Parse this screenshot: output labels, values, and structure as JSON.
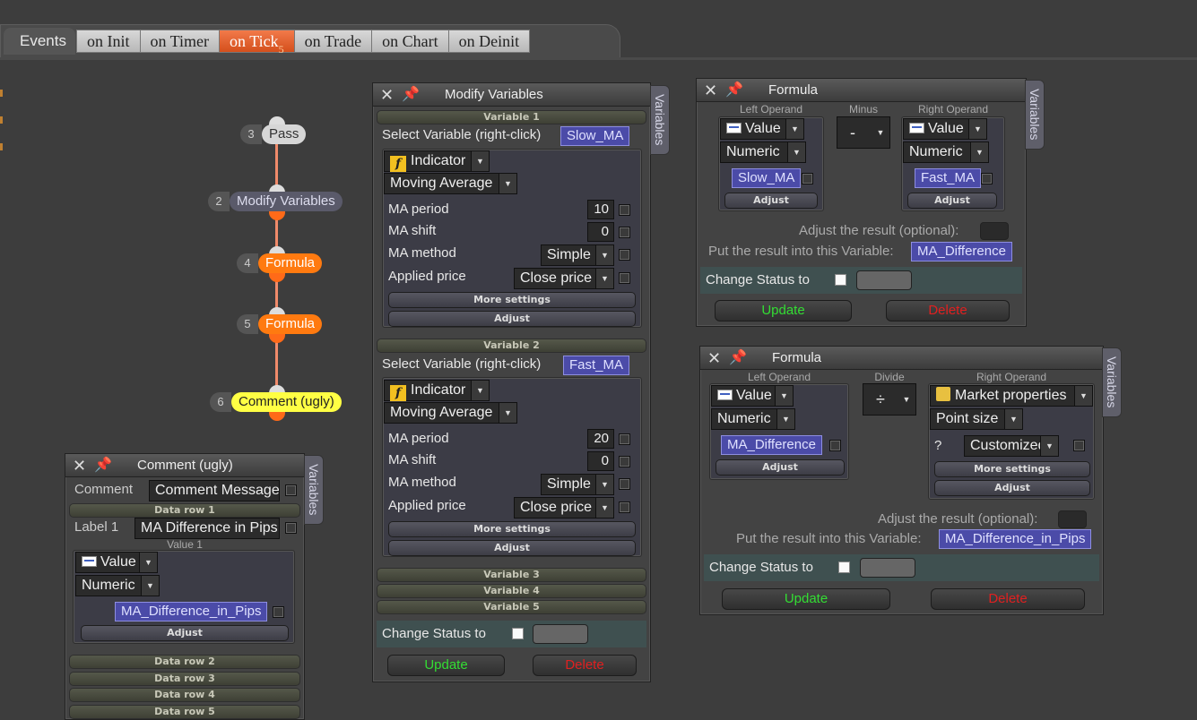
{
  "events": {
    "label": "Events",
    "tabs": [
      {
        "label": "on Init"
      },
      {
        "label": "on Timer"
      },
      {
        "label": "on Tick",
        "badge": "5",
        "active": true
      },
      {
        "label": "on Trade"
      },
      {
        "label": "on Chart"
      },
      {
        "label": "on Deinit"
      }
    ]
  },
  "flow": {
    "nodes": [
      {
        "num": "3",
        "label": "Pass"
      },
      {
        "num": "2",
        "label": "Modify Variables"
      },
      {
        "num": "4",
        "label": "Formula"
      },
      {
        "num": "5",
        "label": "Formula"
      },
      {
        "num": "6",
        "label": "Comment (ugly)"
      }
    ]
  },
  "common": {
    "variables_tab": "Variables",
    "close_glyph": "✕",
    "pin_glyph": "📌",
    "dropdown_arrow": "▼",
    "change_status": "Change Status to",
    "update": "Update",
    "delete": "Delete",
    "adjust": "Adjust",
    "more_settings": "More settings",
    "value": "Value",
    "numeric": "Numeric"
  },
  "modify": {
    "title": "Modify Variables",
    "var1": {
      "header": "Variable 1",
      "select_label": "Select Variable (right-click)",
      "variable": "Slow_MA",
      "type": "Indicator",
      "indicator": "Moving Average",
      "period_label": "MA period",
      "period": "10",
      "shift_label": "MA shift",
      "shift": "0",
      "method_label": "MA method",
      "method": "Simple",
      "price_label": "Applied price",
      "price": "Close price"
    },
    "var2": {
      "header": "Variable 2",
      "select_label": "Select Variable (right-click)",
      "variable": "Fast_MA",
      "type": "Indicator",
      "indicator": "Moving Average",
      "period_label": "MA period",
      "period": "20",
      "shift_label": "MA shift",
      "shift": "0",
      "method_label": "MA method",
      "method": "Simple",
      "price_label": "Applied price",
      "price": "Close price"
    },
    "var3": "Variable 3",
    "var4": "Variable 4",
    "var5": "Variable 5"
  },
  "formula1": {
    "title": "Formula",
    "left_operand": "Left Operand",
    "operator_label": "Minus",
    "operator": "-",
    "right_operand": "Right Operand",
    "left_var": "Slow_MA",
    "right_var": "Fast_MA",
    "adjust_result": "Adjust the result (optional):",
    "put_result": "Put the result into this Variable:",
    "result_var": "MA_Difference"
  },
  "formula2": {
    "title": "Formula",
    "left_operand": "Left Operand",
    "operator_label": "Divide",
    "operator": "÷",
    "right_operand": "Right Operand",
    "left_var": "MA_Difference",
    "right_type": "Market properties",
    "right_sub": "Point size",
    "question": "?",
    "custom": "Customized",
    "adjust_result": "Adjust the result (optional):",
    "put_result": "Put the result into this Variable:",
    "result_var": "MA_Difference_in_Pips"
  },
  "comment": {
    "title": "Comment (ugly)",
    "comment_label": "Comment",
    "comment_value": "Comment Message",
    "row1": "Data row 1",
    "label1": "Label 1",
    "label1_value": "MA Difference in Pips",
    "value1": "Value 1",
    "var": "MA_Difference_in_Pips",
    "row2": "Data row 2",
    "row3": "Data row 3",
    "row4": "Data row 4",
    "row5": "Data row 5"
  },
  "colors": {
    "active_tab": "#e8602a",
    "node_orange": "#ff7a10",
    "node_yellow": "#ffff44",
    "variable_pill": "#4b4ba8",
    "update_green": "#33dd33",
    "delete_red": "#e02020"
  }
}
